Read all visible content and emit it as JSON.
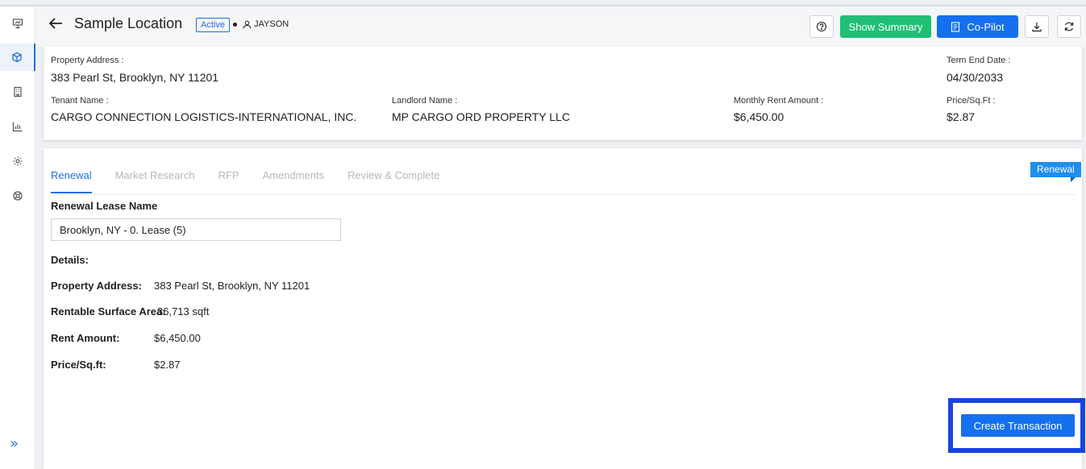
{
  "header": {
    "title": "Sample Location",
    "status": "Active",
    "user": "JAYSON",
    "show_summary_label": "Show Summary",
    "copilot_label": "Co-Pilot"
  },
  "property": {
    "address_label": "Property Address :",
    "address_value": "383 Pearl St, Brooklyn, NY 11201",
    "term_end_label": "Term End Date :",
    "term_end_value": "04/30/2033",
    "tenant_label": "Tenant Name :",
    "tenant_value": "CARGO CONNECTION LOGISTICS-INTERNATIONAL, INC.",
    "landlord_label": "Landlord Name :",
    "landlord_value": "MP CARGO ORD PROPERTY LLC",
    "rent_label": "Monthly Rent Amount :",
    "rent_value": "$6,450.00",
    "price_label": "Price/Sq.Ft :",
    "price_value": "$2.87"
  },
  "tabs": [
    "Renewal",
    "Market Research",
    "RFP",
    "Amendments",
    "Review & Complete"
  ],
  "corner_tag": "Renewal",
  "renewal": {
    "lease_name_label": "Renewal Lease Name",
    "lease_name_value": "Brooklyn, NY - 0. Lease (5)",
    "details_label": "Details:",
    "details": [
      {
        "label": "Property Address:",
        "value": "383 Pearl St, Brooklyn, NY 11201"
      },
      {
        "label": "Rentable Surface Area:",
        "value": "36,713 sqft"
      },
      {
        "label": "Rent Amount:",
        "value": "$6,450.00"
      },
      {
        "label": "Price/Sq.ft:",
        "value": "$2.87"
      }
    ],
    "create_button_label": "Create Transaction"
  },
  "colors": {
    "accent": "#1f6fe5",
    "summary_green": "#1fbf75",
    "highlight": "#1744e0"
  }
}
